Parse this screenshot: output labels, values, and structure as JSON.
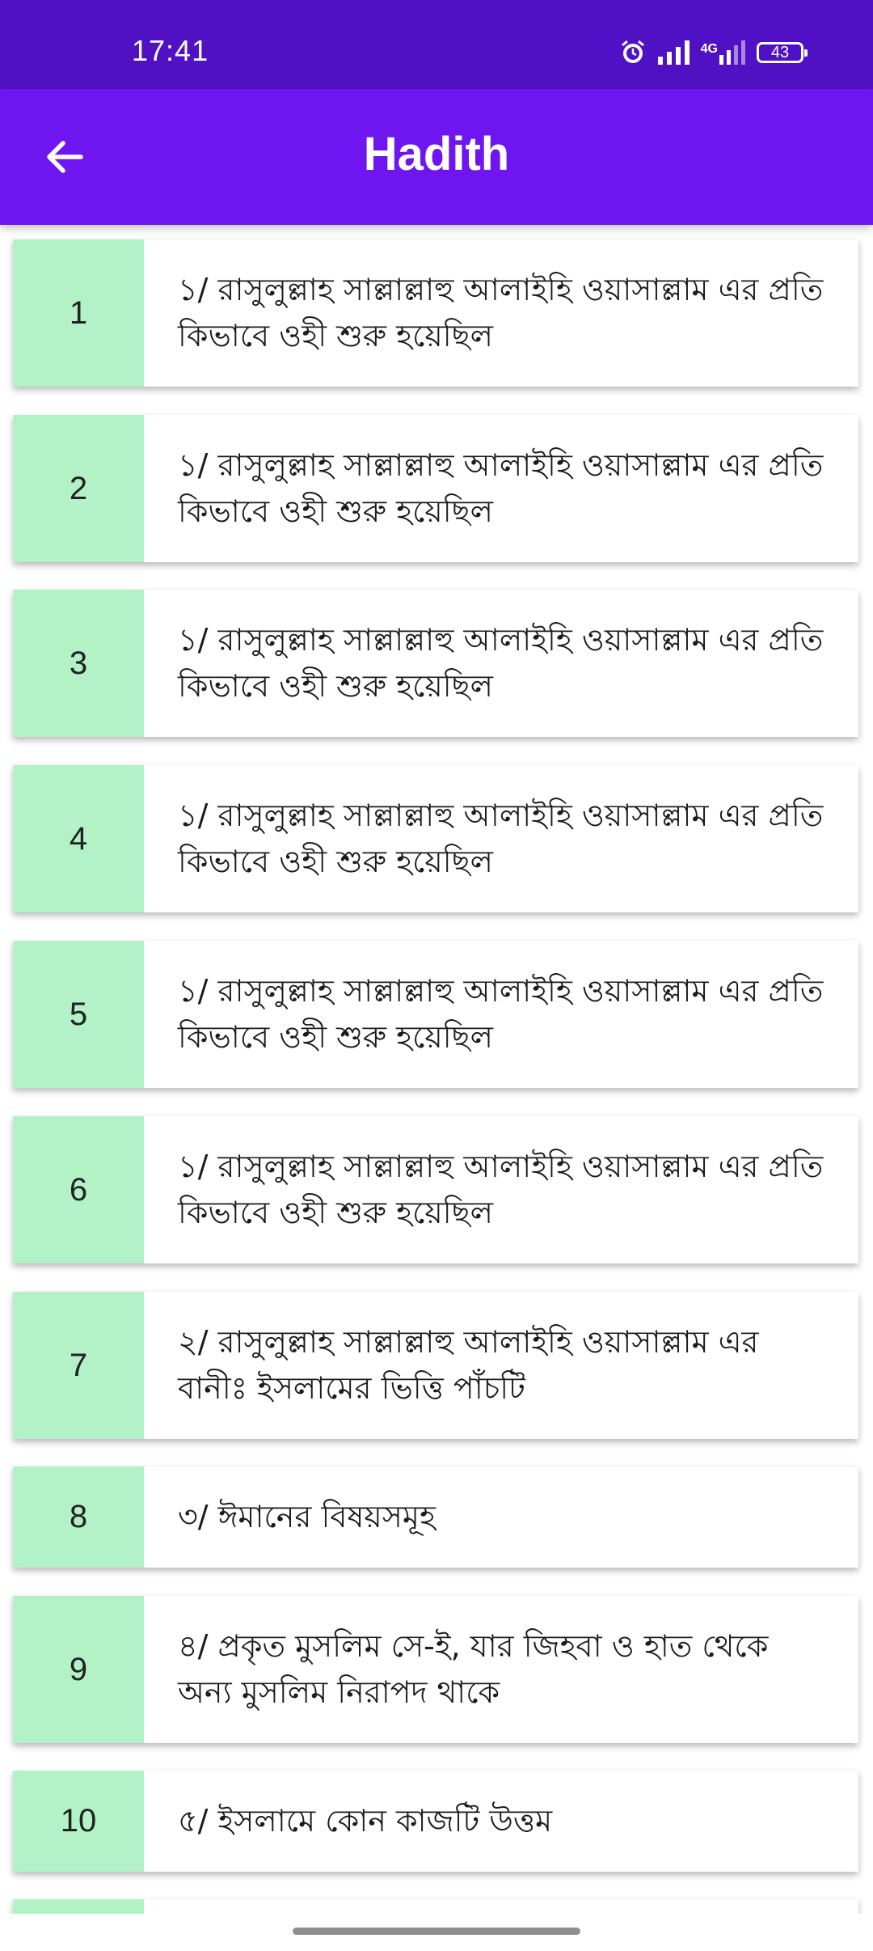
{
  "status_bar": {
    "time": "17:41",
    "network": "4G",
    "battery": "43",
    "icons": [
      "alarm-icon",
      "signal-icon",
      "mobile-data-icon",
      "battery-icon"
    ]
  },
  "app_bar": {
    "title": "Hadith",
    "back_icon": "arrow-left-icon"
  },
  "theme": {
    "status_bar_color": "#5011c4",
    "app_bar_color": "#6f16f0",
    "number_cell_color": "#b3f2c6"
  },
  "hadith_items": [
    {
      "number": "1",
      "text": "১/ রাসুলুল্লাহ সাল্লাল্লাহু আলাইহি ওয়াসাল্লাম এর প্রতি কিভাবে ওহী শুরু হয়েছিল"
    },
    {
      "number": "2",
      "text": "১/ রাসুলুল্লাহ সাল্লাল্লাহু আলাইহি ওয়াসাল্লাম এর প্রতি কিভাবে ওহী শুরু হয়েছিল"
    },
    {
      "number": "3",
      "text": "১/ রাসুলুল্লাহ সাল্লাল্লাহু আলাইহি ওয়াসাল্লাম এর প্রতি কিভাবে ওহী শুরু হয়েছিল"
    },
    {
      "number": "4",
      "text": "১/ রাসুলুল্লাহ সাল্লাল্লাহু আলাইহি ওয়াসাল্লাম এর প্রতি কিভাবে ওহী শুরু হয়েছিল"
    },
    {
      "number": "5",
      "text": "১/ রাসুলুল্লাহ সাল্লাল্লাহু আলাইহি ওয়াসাল্লাম এর প্রতি কিভাবে ওহী শুরু হয়েছিল"
    },
    {
      "number": "6",
      "text": "১/ রাসুলুল্লাহ সাল্লাল্লাহু আলাইহি ওয়াসাল্লাম এর প্রতি কিভাবে ওহী শুরু হয়েছিল"
    },
    {
      "number": "7",
      "text": "২/ রাসুলুল্লাহ সাল্লাল্লাহু আলাইহি ওয়াসাল্লাম এর বানীঃ ইসলামের ভিত্তি পাঁচটি"
    },
    {
      "number": "8",
      "text": "৩/ ঈমানের বিষয়সমূহ"
    },
    {
      "number": "9",
      "text": "৪/ প্রকৃত মুসলিম সে-ই, যার জিহবা ও হাত থেকে অন্য মুসলিম নিরাপদ থাকে"
    },
    {
      "number": "10",
      "text": "৫/ ইসলামে কোন কাজটি উত্তম"
    },
    {
      "number": "",
      "text": ""
    }
  ]
}
